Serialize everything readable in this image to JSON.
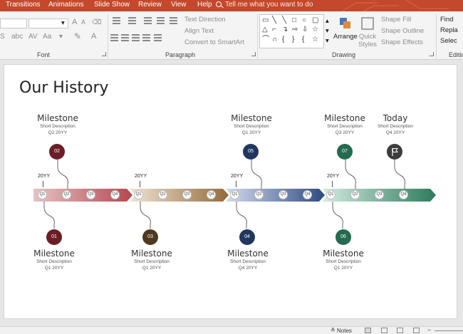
{
  "ribbon_tabs": [
    "Transitions",
    "Animations",
    "Slide Show",
    "Review",
    "View",
    "Help"
  ],
  "tell_me": "Tell me what you want to do",
  "font_group": {
    "label": "Font",
    "size_suffix": "A"
  },
  "paragraph_group": {
    "label": "Paragraph",
    "text_direction": "Text Direction",
    "align_text": "Align Text",
    "convert_smartart": "Convert to SmartArt"
  },
  "drawing_group": {
    "label": "Drawing",
    "arrange": "Arrange",
    "quick_styles": "Quick Styles",
    "shape_fill": "Shape Fill",
    "shape_outline": "Shape Outline",
    "shape_effects": "Shape Effects"
  },
  "editing_group": {
    "label": "Editin",
    "find": "Find",
    "replace": "Repla",
    "select": "Selec"
  },
  "slide": {
    "title": "Our History",
    "top_milestones": [
      {
        "title": "Milestone",
        "desc": "Short Description",
        "date": "Q2 20YY",
        "badge": "02",
        "color": "#6b1e26"
      },
      {
        "title": "Milestone",
        "desc": "Short Description",
        "date": "Q1 20YY",
        "badge": "05",
        "color": "#22375f"
      },
      {
        "title": "Milestone",
        "desc": "Short Description",
        "date": "Q3 20YY",
        "badge": "07",
        "color": "#236a4e"
      },
      {
        "title": "Today",
        "desc": "Short Description",
        "date": "Q4 20YY",
        "badge": "",
        "color": "#3d3d3d"
      }
    ],
    "bottom_milestones": [
      {
        "title": "Milestone",
        "desc": "Short Description",
        "date": "Q1 20YY",
        "badge": "01",
        "color": "#6b1e26"
      },
      {
        "title": "Milestone",
        "desc": "Short Description",
        "date": "Q1 20YY",
        "badge": "03",
        "color": "#4d3a1e"
      },
      {
        "title": "Milestone",
        "desc": "Short Description",
        "date": "Q4 20YY",
        "badge": "04",
        "color": "#22375f"
      },
      {
        "title": "Milestone",
        "desc": "Short Description",
        "date": "Q1 20YY",
        "badge": "06",
        "color": "#236a4e"
      }
    ],
    "year_label": "20YY",
    "quarters": [
      "Q1",
      "Q2",
      "Q3",
      "Q4"
    ],
    "segments": [
      {
        "from": "#e6c3c3",
        "to": "#b5474f"
      },
      {
        "from": "#f0e4d4",
        "to": "#94693a"
      },
      {
        "from": "#d3dcec",
        "to": "#2e4a83"
      },
      {
        "from": "#d6ece2",
        "to": "#2c7a5c"
      }
    ]
  },
  "statusbar": {
    "notes": "Notes"
  }
}
